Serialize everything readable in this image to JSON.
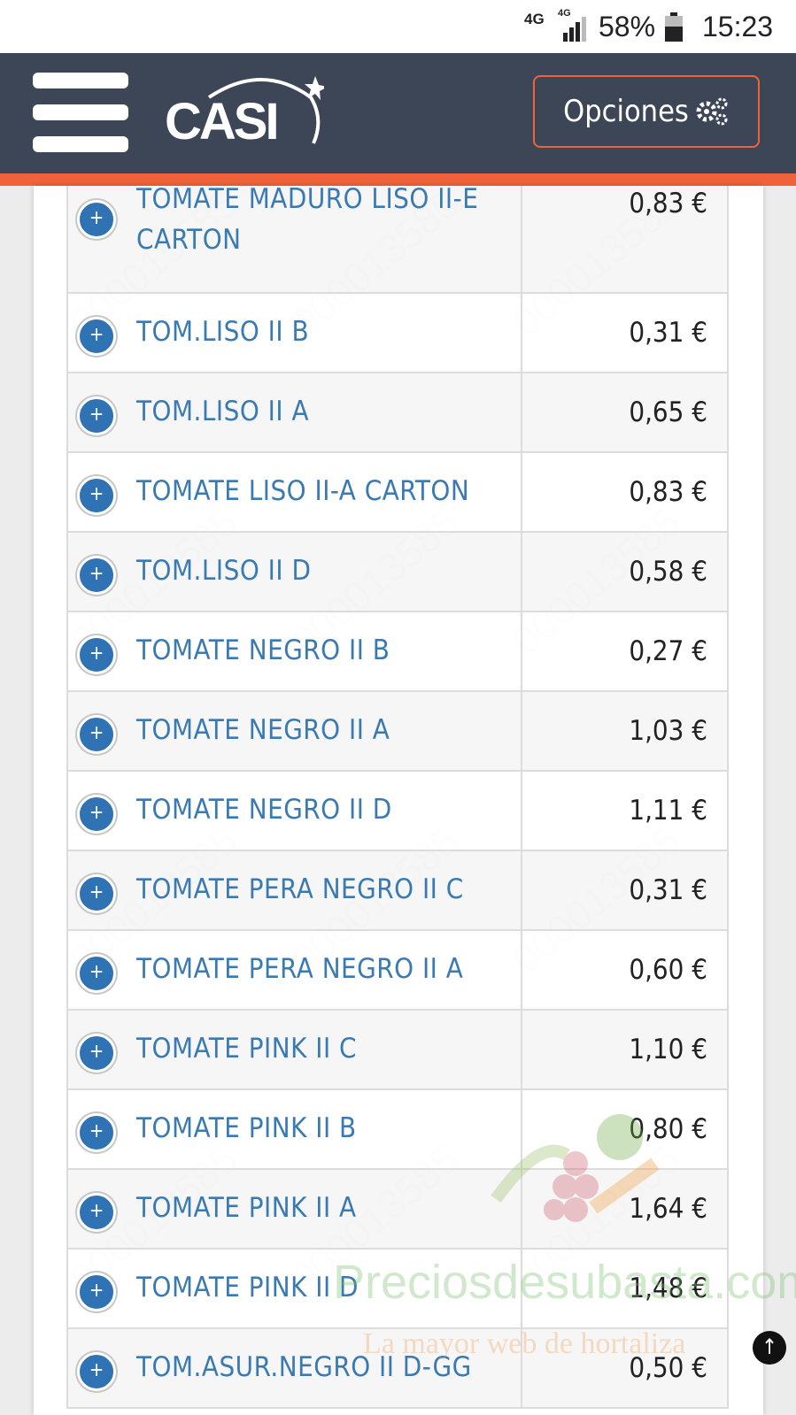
{
  "status_bar": {
    "network": "4G",
    "network_small": "4G",
    "battery": "58%",
    "time": "15:23"
  },
  "header": {
    "logo_text": "CASI",
    "options_label": "Opciones"
  },
  "rows": [
    {
      "name": "TOMATE MADURO LISO II-E CARTON",
      "price": "0,83 €"
    },
    {
      "name": "TOM.LISO II B",
      "price": "0,31 €"
    },
    {
      "name": "TOM.LISO II A",
      "price": "0,65 €"
    },
    {
      "name": "TOMATE LISO II-A CARTON",
      "price": "0,83 €"
    },
    {
      "name": "TOM.LISO II D",
      "price": "0,58 €"
    },
    {
      "name": "TOMATE NEGRO II B",
      "price": "0,27 €"
    },
    {
      "name": "TOMATE NEGRO II A",
      "price": "1,03 €"
    },
    {
      "name": "TOMATE NEGRO II D",
      "price": "1,11 €"
    },
    {
      "name": "TOMATE PERA NEGRO II C",
      "price": "0,31 €"
    },
    {
      "name": "TOMATE PERA NEGRO II A",
      "price": "0,60 €"
    },
    {
      "name": "TOMATE PINK II C",
      "price": "1,10 €"
    },
    {
      "name": "TOMATE PINK II B",
      "price": "0,80 €"
    },
    {
      "name": "TOMATE PINK II A",
      "price": "1,64 €"
    },
    {
      "name": "TOMATE PINK II D",
      "price": "1,48 €"
    },
    {
      "name": "TOM.ASUR.NEGRO II D-GG",
      "price": "0,50 €"
    }
  ],
  "watermark": {
    "site": "Preciosdesubasta.com",
    "slogan": "La mayor web de hortaliza"
  },
  "colors": {
    "header_bg": "#3d4657",
    "accent": "#f0633a",
    "link": "#3a7ab3",
    "plus_button": "#2f73b4"
  }
}
